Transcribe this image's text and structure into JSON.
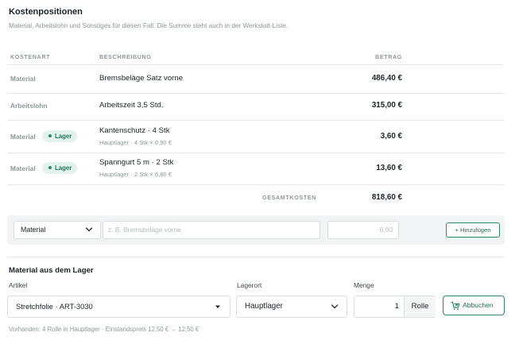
{
  "section": {
    "title": "Kostenpositionen",
    "subtitle": "Material, Arbeitslohn und Sonstiges für diesen Fall. Die Summe steht auch in der Werkstatt-Liste."
  },
  "table": {
    "headers": {
      "type": "KOSTENART",
      "desc": "BESCHREIBUNG",
      "amount": "BETRAG"
    },
    "rows": [
      {
        "type": "Material",
        "badge": "",
        "desc": "Bremsbeläge Satz vorne",
        "sub": "",
        "amount": "486,40 €"
      },
      {
        "type": "Arbeitslohn",
        "badge": "",
        "desc": "Arbeitszeit 3,5 Std.",
        "sub": "",
        "amount": "315,00 €"
      },
      {
        "type": "Material",
        "badge": "Lager",
        "desc": "Kantenschutz · 4 Stk",
        "sub": "Hauptlager · 4 Stk × 0,90 €",
        "amount": "3,60 €"
      },
      {
        "type": "Material",
        "badge": "Lager",
        "desc": "Spanngurt 5 m · 2 Stk",
        "sub": "Hauptlager · 2 Stk × 6,80 €",
        "amount": "13,60 €"
      }
    ],
    "total_label": "GESAMTKOSTEN",
    "total_amount": "818,60 €"
  },
  "add_row": {
    "type_value": "Material",
    "desc_placeholder": "z. B. Bremsbeläge vorne",
    "amount_placeholder": "0,00",
    "add_button": "+ Hinzufügen"
  },
  "stock_section": {
    "title": "Material aus dem Lager",
    "article_label": "Artikel",
    "article_value": "Stretchfolie · ART-3030",
    "location_label": "Lagerort",
    "location_value": "Hauptlager",
    "quantity_label": "Menge",
    "quantity_value": "1",
    "unit": "Rolle",
    "book_button": "Abbuchen",
    "availability": "Vorhanden: 4 Rolle in Hauptlager · Einstandspreis 12,50 € → 12,50 €"
  },
  "colors": {
    "accent": "#2e8a66",
    "badge_bg": "#e3f2ec",
    "muted": "#8f999b"
  },
  "icons": {
    "dropdown": "chevron-down-icon",
    "select": "caret-down-icon",
    "book": "cart-arrow-icon"
  }
}
